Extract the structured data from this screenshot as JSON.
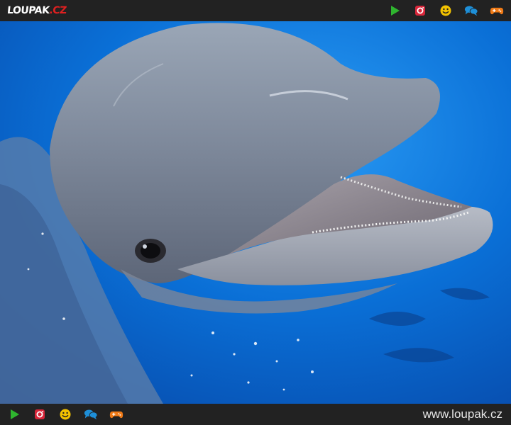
{
  "header": {
    "logo_main": "LOUPAK",
    "logo_tld": ".CZ",
    "icons": [
      "play-icon",
      "instagram-icon",
      "smiley-icon",
      "chat-icon",
      "gamepad-icon"
    ]
  },
  "photo": {
    "subject": "dolphin-photo"
  },
  "footer": {
    "icons": [
      "play-icon",
      "instagram-icon",
      "smiley-icon",
      "chat-icon",
      "gamepad-icon"
    ],
    "url": "www.loupak.cz"
  },
  "colors": {
    "bar": "#222222",
    "logo_accent": "#e02020",
    "play": "#2fb52f",
    "instagram": "#d8263a",
    "smiley": "#f2c200",
    "chat": "#1e8fd8",
    "gamepad": "#f07a16",
    "water": "#0a6fd6"
  }
}
